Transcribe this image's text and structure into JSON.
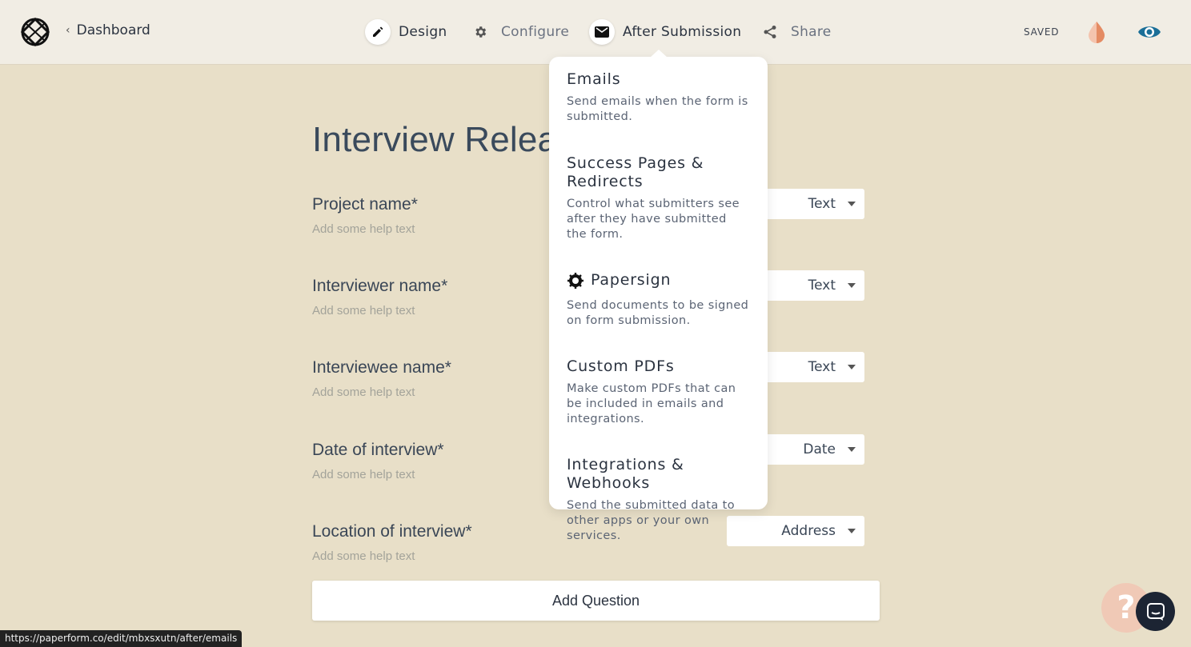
{
  "header": {
    "back_label": "Dashboard",
    "nav": [
      {
        "label": "Design",
        "icon": "pencil-icon",
        "active": true
      },
      {
        "label": "Configure",
        "icon": "gear-icon",
        "active": false
      },
      {
        "label": "After Submission",
        "icon": "mail-icon",
        "active": true
      },
      {
        "label": "Share",
        "icon": "share-icon",
        "active": false
      }
    ],
    "status": "SAVED"
  },
  "form": {
    "title": "Interview Release",
    "questions": [
      {
        "label": "Project name*",
        "help": "Add some help text",
        "type": "Text"
      },
      {
        "label": "Interviewer name*",
        "help": "Add some help text",
        "type": "Text"
      },
      {
        "label": "Interviewee name*",
        "help": "Add some help text",
        "type": "Text"
      },
      {
        "label": "Date of interview*",
        "help": "Add some help text",
        "type": "Date"
      },
      {
        "label": "Location of interview*",
        "help": "Add some help text",
        "type": "Address"
      }
    ],
    "add_question_label": "Add Question"
  },
  "dropdown": {
    "items": [
      {
        "title": "Emails",
        "desc": "Send emails when the form is submitted."
      },
      {
        "title": "Success Pages & Redirects",
        "desc": "Control what submitters see after they have submitted the form."
      },
      {
        "title": "Papersign",
        "desc": "Send documents to be signed on form submission.",
        "icon": "papersign-icon"
      },
      {
        "title": "Custom PDFs",
        "desc": "Make custom PDFs that can be included in emails and integrations."
      },
      {
        "title": "Integrations & Webhooks",
        "desc": "Send the submitted data to other apps or your own services."
      }
    ]
  },
  "status_bar": {
    "url": "https://paperform.co/edit/mbxsxutn/after/emails"
  },
  "colors": {
    "background": "#e8dfc8",
    "topbar": "#f1ede4",
    "accent": "#e8a386",
    "chat": "#1c2433"
  }
}
